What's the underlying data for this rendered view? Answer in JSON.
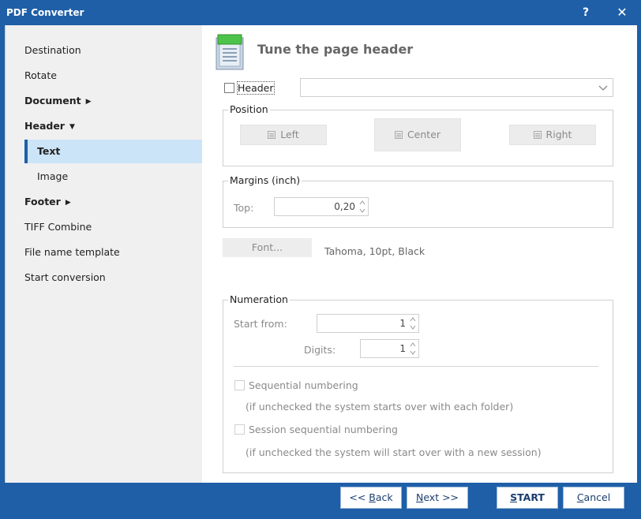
{
  "window": {
    "title": "PDF Converter",
    "help_label": "?",
    "close_label": "✕"
  },
  "sidebar": {
    "items": [
      {
        "label": "Destination"
      },
      {
        "label": "Rotate"
      },
      {
        "label": "Document"
      },
      {
        "label": "Header"
      },
      {
        "label": "Text",
        "selected": true
      },
      {
        "label": "Image"
      },
      {
        "label": "Footer"
      },
      {
        "label": "TIFF Combine"
      },
      {
        "label": "File name template"
      },
      {
        "label": "Start conversion"
      }
    ]
  },
  "page": {
    "title": "Tune the page header",
    "icon": "page-header-icon"
  },
  "header_option": {
    "label": "Header",
    "checked": false,
    "combo_value": ""
  },
  "position": {
    "title": "Position",
    "left": "Left",
    "center": "Center",
    "right": "Right"
  },
  "margins": {
    "title": "Margins (inch)",
    "top_label": "Top:",
    "top_value": "0,20"
  },
  "font": {
    "button": "Font...",
    "description": "Tahoma, 10pt, Black"
  },
  "numeration": {
    "title": "Numeration",
    "start_label": "Start from:",
    "start_value": "1",
    "digits_label": "Digits:",
    "digits_value": "1",
    "sequential_label": "Sequential numbering",
    "sequential_hint": "(if unchecked the system starts over with each folder)",
    "session_label": "Session sequential numbering",
    "session_hint": "(if unchecked the system will start over with a new session)"
  },
  "footer": {
    "back_prefix": "<< ",
    "back_key": "B",
    "back_rest": "ack",
    "next_key": "N",
    "next_rest": "ext >>",
    "start_key": "S",
    "start_rest": "TART",
    "cancel_key": "C",
    "cancel_rest": "ancel"
  },
  "colors": {
    "accent": "#1e5fa8",
    "selection": "#cce4f7",
    "sidebar_bg": "#f0f0f0"
  }
}
